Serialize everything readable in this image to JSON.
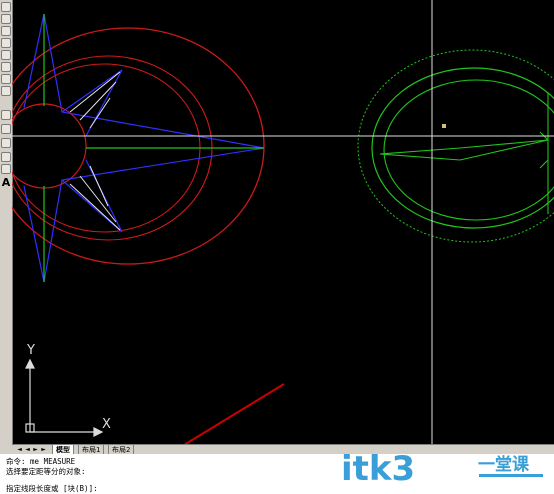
{
  "canvas": {
    "axis_y_label": "Y",
    "axis_x_label": "X",
    "colors": {
      "background": "#000000",
      "red": "#cc1a1a",
      "blue": "#3030ff",
      "green": "#22c41c",
      "white": "#e6e6e6",
      "crosshair": "#e0e0e0"
    }
  },
  "toolbar": {
    "text_tool_letter": "A",
    "icons": [
      "line-icon",
      "circle-icon",
      "arc-icon",
      "spline-icon",
      "ellipse-icon",
      "insert-icon",
      "block-icon",
      "point-icon",
      "hatch-icon",
      "gradient-icon",
      "region-icon",
      "table-icon",
      "text-icon"
    ]
  },
  "tabs": {
    "model": "模型",
    "layout1": "布局1",
    "layout2": "布局2"
  },
  "command": {
    "line1": "命令: me MEASURE",
    "line2": "选择要定距等分的对象:",
    "line3": "指定线段长度或 [块(B)]:"
  },
  "watermark": {
    "text": "itk3",
    "cn": "一堂课"
  }
}
